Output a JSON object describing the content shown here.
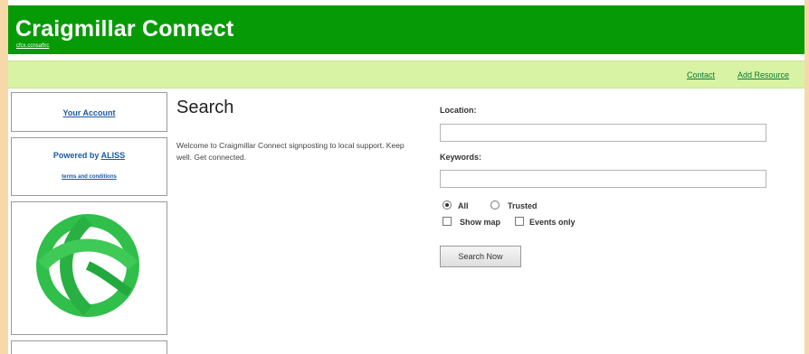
{
  "header": {
    "title": "Craigmillar Connect",
    "subtitle": "cfcx.ccnsaftrc"
  },
  "nav": {
    "contact": "Contact",
    "add_resource": "Add Resource"
  },
  "sidebar": {
    "account_link": "Your Account",
    "powered_by": "Powered by",
    "aliss": "ALISS",
    "terms": "terms and conditions"
  },
  "main": {
    "title": "Search",
    "welcome": "Welcome to Craigmillar Connect signposting to local support. Keep well. Get connected."
  },
  "search_form": {
    "location_label": "Location:",
    "location_value": "",
    "keywords_label": "Keywords:",
    "keywords_value": "",
    "filter_all": "All",
    "filter_trusted": "Trusted",
    "selected_filter": "All",
    "show_map": "Show map",
    "show_map_checked": false,
    "events_only": "Events only",
    "events_only_checked": false,
    "submit": "Search Now"
  },
  "colors": {
    "header_green": "#069b06",
    "nav_green": "#d7f3a3",
    "page_border": "#f7d8a8",
    "link_blue": "#1a5aa0",
    "logo_green": "#2fbf4a"
  }
}
